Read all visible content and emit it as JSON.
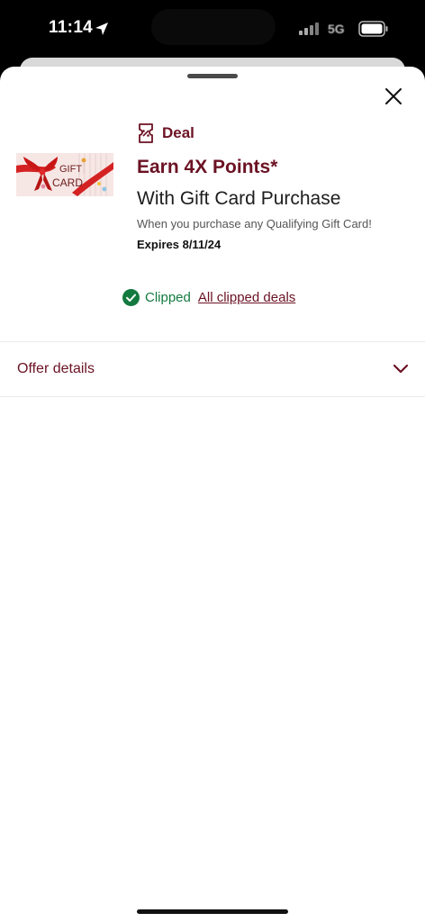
{
  "status_bar": {
    "time": "11:14",
    "network": "5G",
    "icons": [
      "location-arrow-icon",
      "cellular-signal-icon",
      "battery-icon"
    ]
  },
  "deal": {
    "tag_label": "Deal",
    "image_text": "GIFT CARD",
    "title": "Earn 4X Points*",
    "subtitle": "With Gift Card Purchase",
    "description": "When you purchase any Qualifying Gift Card!",
    "expiry": "Expires 8/11/24"
  },
  "clip_status": {
    "clipped_label": "Clipped",
    "all_clipped_link": "All clipped deals"
  },
  "offer_details": {
    "label": "Offer details"
  },
  "colors": {
    "brand": "#6b1223",
    "clipped_green": "#137a3f"
  }
}
